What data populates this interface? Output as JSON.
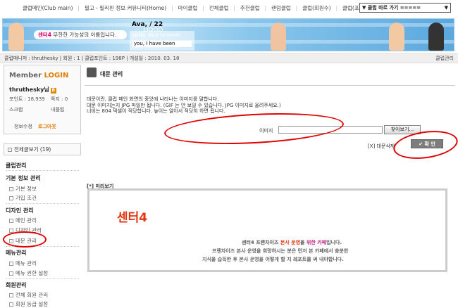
{
  "topnav": {
    "items": [
      "클럽메인(Club main)",
      "필고 - 필리핀 정보 커뮤니티(Home)",
      "마이클럽",
      "전체클럽",
      "추천클럽",
      "랜덤클럽",
      "클럽(회원수)",
      "클럽(포인트)"
    ],
    "jump_select": "▼ 클럽 바로 가기 ====="
  },
  "banner": {
    "slogan_brand": "센터4",
    "slogan_text": " 무한한 가능성의 이름입니다.",
    "date": "Ava, / 22",
    "ticker_line1": "Hello, Nice to meet",
    "ticker_line2": "you, I have been"
  },
  "infobar": {
    "text": "클럽매니저 : thruthesky | 회원 : 1 | 클럽포인트 : 198P | 개설일 : 2010. 03. 18",
    "right": "클럽관리"
  },
  "member": {
    "title_part1": "Member ",
    "title_part2": "LOGIN",
    "username": "thruthesky님",
    "points_label": "포인트 : 18,939",
    "notes_label": "쪽지 : 0",
    "scrap": "스크랩",
    "mywrites": "내플럽",
    "edit_info": "정보수정",
    "logout": "로그아웃"
  },
  "sidebar": {
    "view_all": "전체글보기 (19)",
    "club_admin": "클럽관리",
    "basic_title": "기본 정보 관리",
    "basic_items": [
      "기본 정보",
      "가입 조건"
    ],
    "design_title": "디자인 관리",
    "design_items": [
      "메인 관리",
      "디자인 관리",
      "대문 관리"
    ],
    "menu_title": "메뉴관리",
    "menu_items": [
      "메뉴 관리",
      "메뉴 권한 설정"
    ],
    "member_title": "회원관리",
    "member_items": [
      "전체 회원 관리",
      "회원 등급 설정"
    ]
  },
  "main": {
    "title": "대문 관리",
    "desc_lines": [
      "대문이란, 클럽 메인 화면의 중앙에 나타나는 이미지를 말합니다.",
      "대문 이미지는지 JPG 파일만 됩니다. (GIF 는 안 보일 수 있습니다. JPG 이미지로 올려주세요.)",
      "너비는 804 픽셀이 적당합니다. 높이는 알아서 적당히 하면 됩니다."
    ],
    "file_label": "이미지",
    "browse_button": "찾아보기...",
    "delete_link": "[X] 대문삭제",
    "confirm_button": "✔ 확 인",
    "preview_label": "[*] 미리보기",
    "preview": {
      "logo": "센터4",
      "line1_a": "센터4 프랜차이즈 ",
      "line1_hl1": "본사 운영",
      "line1_mid": "을 ",
      "line1_hl2": "위한 카페",
      "line1_end": "입니다.",
      "line2": "프랜차이즈 본사 운영을 희망하시는 분은 먼저 본 카페에서 충분한",
      "line3": "지식을 습득한 후 본사 운영을 어떻게 할 지 레포트를 써 내야합니다."
    }
  },
  "colors": {
    "annotation": "#e00000",
    "brand_orange": "#e07b00",
    "preview_red": "#e2340f"
  }
}
